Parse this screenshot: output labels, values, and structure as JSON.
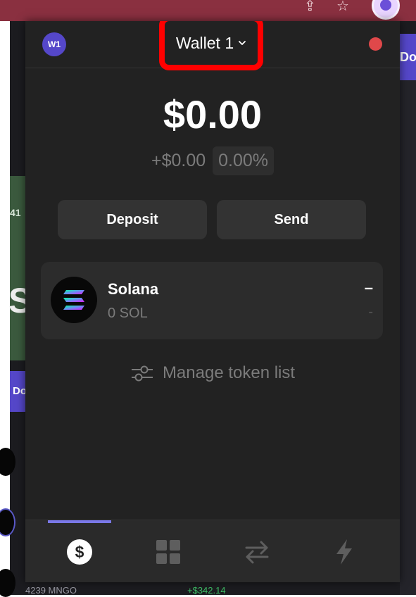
{
  "header": {
    "avatar_initials": "W1",
    "wallet_name": "Wallet 1",
    "status_color": "#e0484a",
    "highlight_color": "#ff0000"
  },
  "balance": {
    "total": "$0.00",
    "change_abs": "+$0.00",
    "change_pct": "0.00%"
  },
  "actions": {
    "deposit_label": "Deposit",
    "send_label": "Send"
  },
  "tokens": [
    {
      "name": "Solana",
      "amount": "0 SOL",
      "value": "–",
      "change": "-",
      "icon": "solana-logo"
    }
  ],
  "manage_label": "Manage token list",
  "bottom_nav": {
    "items": [
      {
        "icon": "dollar-icon",
        "active": true
      },
      {
        "icon": "grid-icon",
        "active": false
      },
      {
        "icon": "swap-icon",
        "active": false
      },
      {
        "icon": "lightning-icon",
        "active": false
      }
    ],
    "accent": "#7a78e8"
  },
  "background": {
    "left_tab_label": "41",
    "left_big_char": "S",
    "left_button_label": "Do",
    "right_button_label": "Do",
    "token_row_amount": "4239 MNGO",
    "token_row_change": "+$342.14"
  }
}
